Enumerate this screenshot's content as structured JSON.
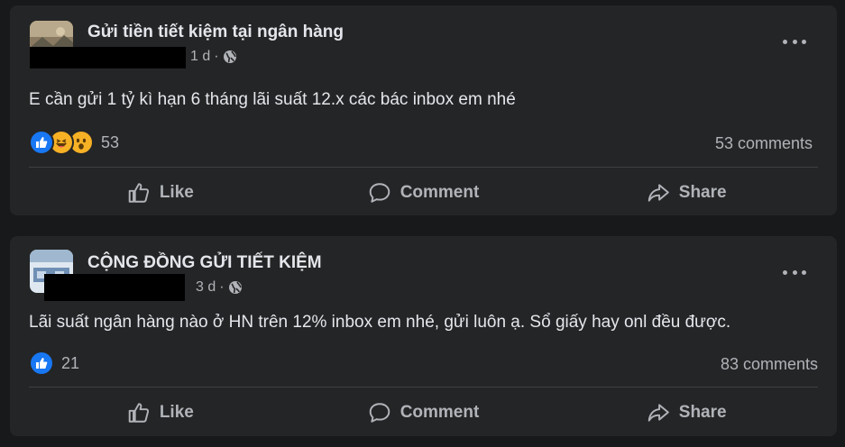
{
  "posts": [
    {
      "title": "Gửi tiền tiết kiệm tại ngân hàng",
      "time": "1 d",
      "separator": "·",
      "body": "E cần gửi 1 tỷ kì hạn 6 tháng lãi suất 12.x các bác inbox em nhé",
      "reactions": [
        "like-icon",
        "haha-icon",
        "wow-icon"
      ],
      "reaction_count": "53",
      "comments": "53 comments"
    },
    {
      "title": "CỘNG ĐỒNG GỬI TIẾT KIỆM",
      "time": "3 d",
      "separator": "·",
      "body": "Lãi suất ngân hàng nào ở HN trên 12% inbox em nhé, gửi luôn ạ. Sổ giấy hay onl đều được.",
      "reactions": [
        "like-icon"
      ],
      "reaction_count": "21",
      "comments": "83 comments"
    }
  ],
  "actions": {
    "like": "Like",
    "comment": "Comment",
    "share": "Share"
  },
  "colors": {
    "background": "#18191a",
    "card": "#242526",
    "like_blue": "#1877f2",
    "reaction_yellow": "#f7b125"
  }
}
